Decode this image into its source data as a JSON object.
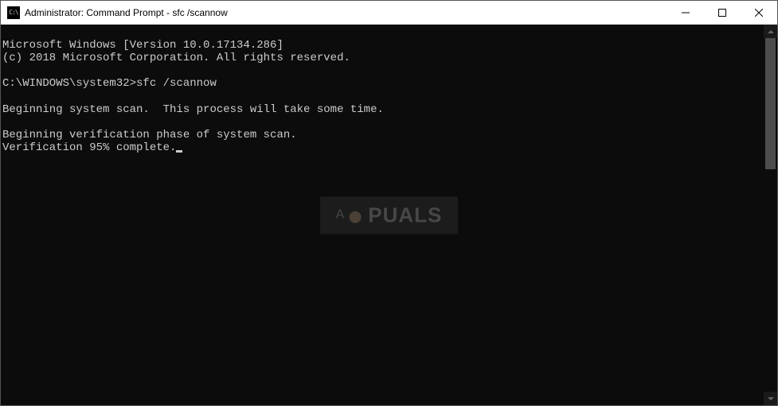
{
  "titlebar": {
    "icon_label": "cmd-icon",
    "title": "Administrator: Command Prompt - sfc  /scannow"
  },
  "window_controls": {
    "minimize": "minimize",
    "maximize": "maximize",
    "close": "close"
  },
  "terminal": {
    "lines": [
      "Microsoft Windows [Version 10.0.17134.286]",
      "(c) 2018 Microsoft Corporation. All rights reserved.",
      "",
      "C:\\WINDOWS\\system32>sfc /scannow",
      "",
      "Beginning system scan.  This process will take some time.",
      "",
      "Beginning verification phase of system scan.",
      "Verification 95% complete."
    ]
  },
  "watermark": {
    "text_prefix": "A",
    "text_suffix": "PUALS"
  }
}
